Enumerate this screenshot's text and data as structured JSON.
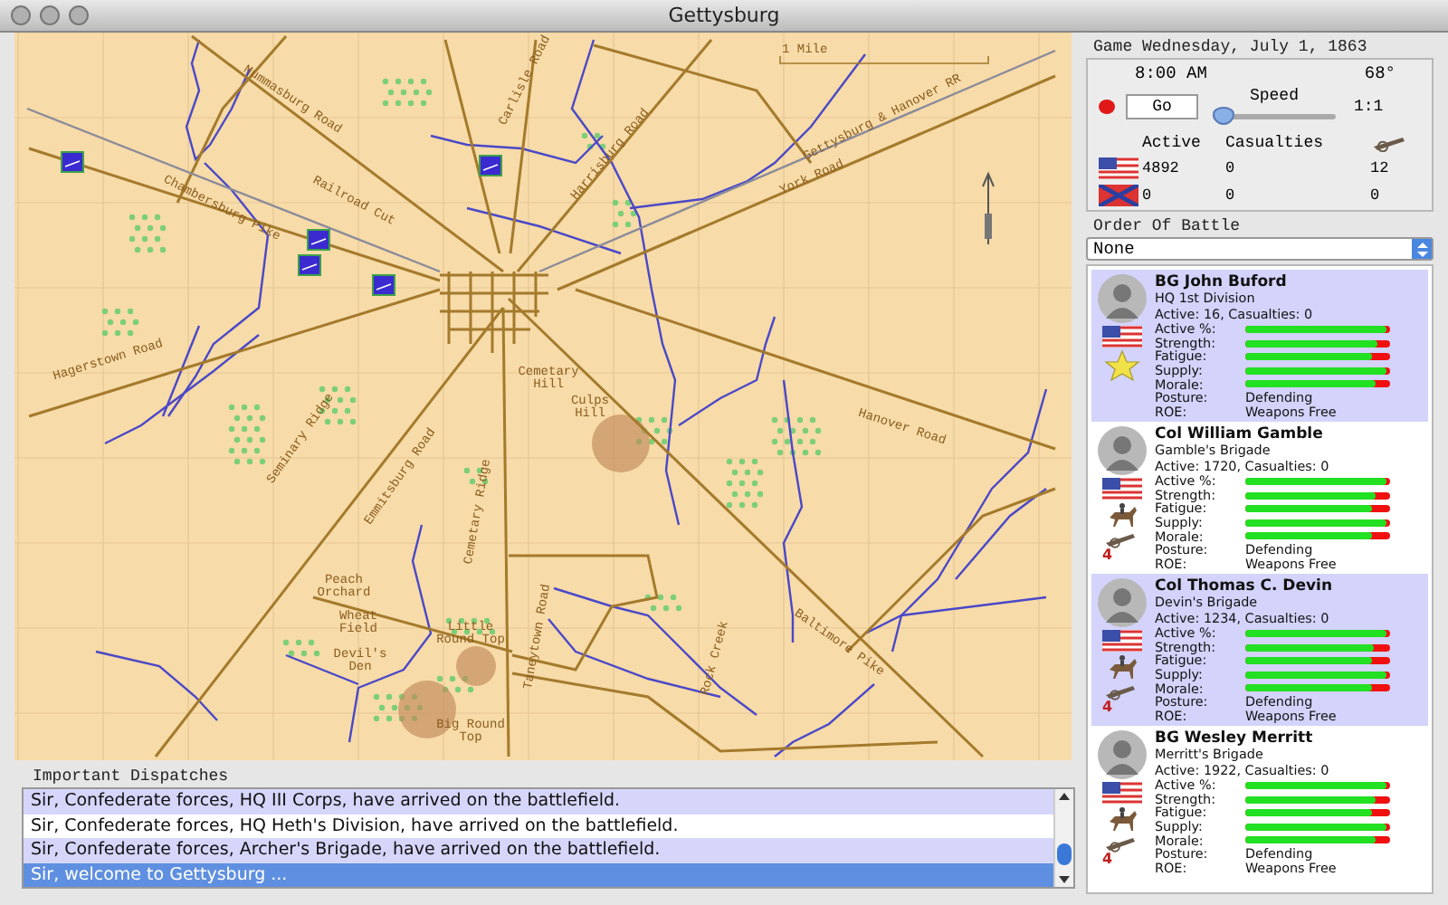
{
  "window": {
    "title": "Gettysburg"
  },
  "map": {
    "scale_label": "1 Mile",
    "labels": [
      {
        "text": "Mummasburg Road"
      },
      {
        "text": "Carlisle Road"
      },
      {
        "text": "Harrisburg Road"
      },
      {
        "text": "Gettysburg & Hanover RR"
      },
      {
        "text": "York Road"
      },
      {
        "text": "Railroad Cut"
      },
      {
        "text": "Chambersburg Pike"
      },
      {
        "text": "Hagerstown Road"
      },
      {
        "text": "Cemetary Hill"
      },
      {
        "text": "Culps Hill"
      },
      {
        "text": "Seminary Ridge"
      },
      {
        "text": "Emmitsburg Road"
      },
      {
        "text": "Cemetary Ridge"
      },
      {
        "text": "Hanover Road"
      },
      {
        "text": "Peach Orchard"
      },
      {
        "text": "Wheat Field"
      },
      {
        "text": "Devil's Den"
      },
      {
        "text": "Little Round Top"
      },
      {
        "text": "Taneytown Road"
      },
      {
        "text": "Rock Creek"
      },
      {
        "text": "Baltimore Pike"
      },
      {
        "text": "Big Round Top"
      }
    ]
  },
  "dispatches": {
    "title": "Important Dispatches",
    "items": [
      {
        "text": "Sir, Confederate forces, HQ III Corps, have arrived on the battlefield.",
        "selected": false
      },
      {
        "text": "Sir, Confederate forces, HQ Heth's Division, have arrived on the battlefield.",
        "selected": false
      },
      {
        "text": "Sir, Confederate forces, Archer's Brigade, have arrived on the battlefield.",
        "selected": false
      },
      {
        "text": "Sir, welcome to Gettysburg ...",
        "selected": true
      }
    ]
  },
  "game": {
    "date": "Game Wednesday, July 1, 1863",
    "time": "8:00 AM",
    "temperature": "68°",
    "go_button": "Go",
    "speed_label": "Speed",
    "speed": {
      "level": 0.0,
      "reading": "1:1"
    },
    "columns": [
      "Active",
      "Casualties"
    ],
    "forces": [
      {
        "confederate": false,
        "values": [
          "4892",
          "0",
          "12"
        ]
      },
      {
        "confederate": true,
        "values": [
          "0",
          "0",
          "0"
        ]
      }
    ]
  },
  "order_of_battle": {
    "title": "Order Of Battle",
    "filter": "None",
    "units": [
      {
        "name": "BG John Buford",
        "unit": "HQ 1st Division",
        "summary": "Active: 16, Casualties: 0",
        "confederate": false,
        "kind": "hq",
        "stats": [
          {
            "label": "Active %:",
            "level": 0.97
          },
          {
            "label": "Strength:",
            "level": 0.91
          },
          {
            "label": "Fatigue:",
            "level": 0.88
          },
          {
            "label": "Supply:",
            "level": 0.97
          },
          {
            "label": "Morale:",
            "level": 0.9
          }
        ],
        "posture": {
          "label": "Posture:",
          "value": "Defending"
        },
        "roe": {
          "label": "ROE:",
          "value": "Weapons Free"
        }
      },
      {
        "name": "Col William Gamble",
        "unit": "Gamble's Brigade",
        "summary": "Active: 1720, Casualties: 0",
        "confederate": false,
        "kind": "cavalry",
        "artillery": "4",
        "stats": [
          {
            "label": "Active %:",
            "level": 0.97
          },
          {
            "label": "Strength:",
            "level": 0.9
          },
          {
            "label": "Fatigue:",
            "level": 0.87
          },
          {
            "label": "Supply:",
            "level": 0.97
          },
          {
            "label": "Morale:",
            "level": 0.87
          }
        ],
        "posture": {
          "label": "Posture:",
          "value": "Defending"
        },
        "roe": {
          "label": "ROE:",
          "value": "Weapons Free"
        }
      },
      {
        "name": "Col Thomas C. Devin",
        "unit": "Devin's Brigade",
        "summary": "Active: 1234, Casualties: 0",
        "confederate": false,
        "kind": "cavalry",
        "artillery": "4",
        "stats": [
          {
            "label": "Active %:",
            "level": 0.97
          },
          {
            "label": "Strength:",
            "level": 0.89
          },
          {
            "label": "Fatigue:",
            "level": 0.87
          },
          {
            "label": "Supply:",
            "level": 0.97
          },
          {
            "label": "Morale:",
            "level": 0.87
          }
        ],
        "posture": {
          "label": "Posture:",
          "value": "Defending"
        },
        "roe": {
          "label": "ROE:",
          "value": "Weapons Free"
        }
      },
      {
        "name": "BG Wesley Merritt",
        "unit": "Merritt's Brigade",
        "summary": "Active: 1922, Casualties: 0",
        "confederate": false,
        "kind": "cavalry",
        "artillery": "4",
        "stats": [
          {
            "label": "Active %:",
            "level": 0.97
          },
          {
            "label": "Strength:",
            "level": 0.9
          },
          {
            "label": "Fatigue:",
            "level": 0.87
          },
          {
            "label": "Supply:",
            "level": 0.97
          },
          {
            "label": "Morale:",
            "level": 0.9
          }
        ],
        "posture": {
          "label": "Posture:",
          "value": "Defending"
        },
        "roe": {
          "label": "ROE:",
          "value": "Weapons Free"
        }
      }
    ]
  }
}
